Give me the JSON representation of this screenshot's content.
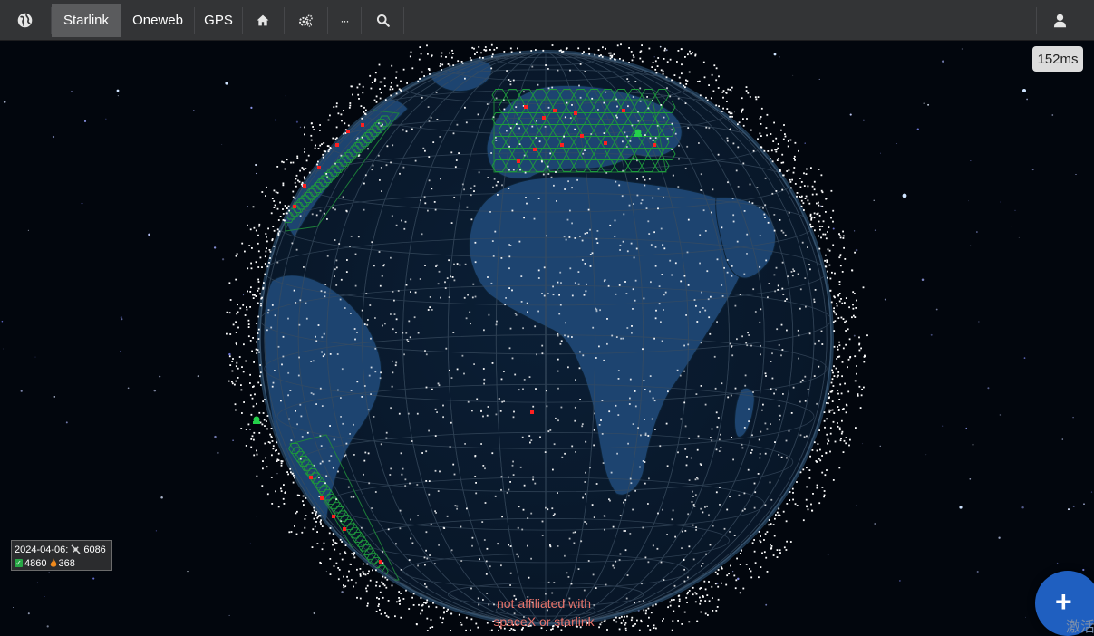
{
  "navbar": {
    "globe_icon": "globe-icon",
    "tabs": [
      {
        "label": "Starlink",
        "active": true
      },
      {
        "label": "Oneweb",
        "active": false
      },
      {
        "label": "GPS",
        "active": false
      }
    ],
    "home_icon": "home-icon",
    "settings_icon": "gears-icon",
    "more_label": "···",
    "search_icon": "search-icon",
    "user_icon": "user-icon"
  },
  "latency": "152ms",
  "stats": {
    "date": "2024-04-06:",
    "satellite_icon": "satellite-icon",
    "total": "6086",
    "active_icon": "check-icon",
    "active": "4860",
    "deorbit_icon": "flame-icon",
    "deorbiting": "368"
  },
  "disclaimer": {
    "line1": "not affiliated with",
    "line2": "spaceX or starlink"
  },
  "fab": {
    "icon": "plus-icon",
    "text": "激活"
  },
  "colors": {
    "navbar": "#333436",
    "active_tab": "#5a5b5d",
    "ocean": "#0a1d33",
    "land": "#1d4470",
    "satellite": "#ffffff",
    "coverage": "#2ea043",
    "ground_station": "#ff2020",
    "disclaimer": "#e7736b",
    "fab": "#1f5fc0"
  }
}
